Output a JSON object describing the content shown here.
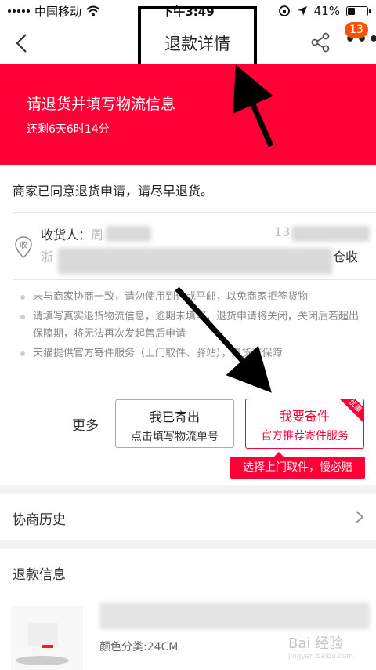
{
  "status_bar": {
    "carrier": "中国移动",
    "time": "下午3:49",
    "battery_text": "41%",
    "battery_level": 0.41,
    "icons": [
      "signal-icon",
      "wifi-icon",
      "lock-rotation-icon",
      "location-icon",
      "battery-icon"
    ]
  },
  "nav": {
    "title": "退款详情",
    "badge_count": "13",
    "icons": [
      "back-icon",
      "share-icon",
      "more-icon"
    ]
  },
  "banner": {
    "title": "请退货并填写物流信息",
    "countdown": "还剩6天6时14分",
    "color": "#ff0036"
  },
  "merchant_status": "商家已同意退货申请，请尽早退货。",
  "address": {
    "icon_char": "收",
    "receiver_label": "收货人：",
    "receiver_name_partial": "周",
    "phone_partial": "13",
    "address_start": "浙",
    "address_end": "仓收"
  },
  "notes": [
    "未与商家协商一致，请勿使用到付或平邮，以免商家拒签货物",
    "请填写真实退货物流信息，逾期未填写，退货申请将关闭，关闭后若超出保障期，将无法再次发起售后申请",
    "天猫提供官方寄件服务（上门取件、驿站），退货有保障"
  ],
  "actions": {
    "more_label": "更多",
    "sent_title": "我已寄出",
    "sent_subtitle": "点击填写物流单号",
    "ship_title": "我要寄件",
    "ship_subtitle": "官方推荐寄件服务",
    "ship_corner_tag": "优惠",
    "tooltip": "选择上门取件，慢必赔"
  },
  "history": {
    "label": "协商历史"
  },
  "refund_info": {
    "label": "退款信息",
    "spec": "颜色分类:24CM"
  },
  "watermark": {
    "text": "Bai 经验",
    "sub": "jingyan.baidu.com"
  },
  "colors": {
    "accent": "#ff0036",
    "badge": "#ff5000",
    "annotation": "#000000"
  }
}
